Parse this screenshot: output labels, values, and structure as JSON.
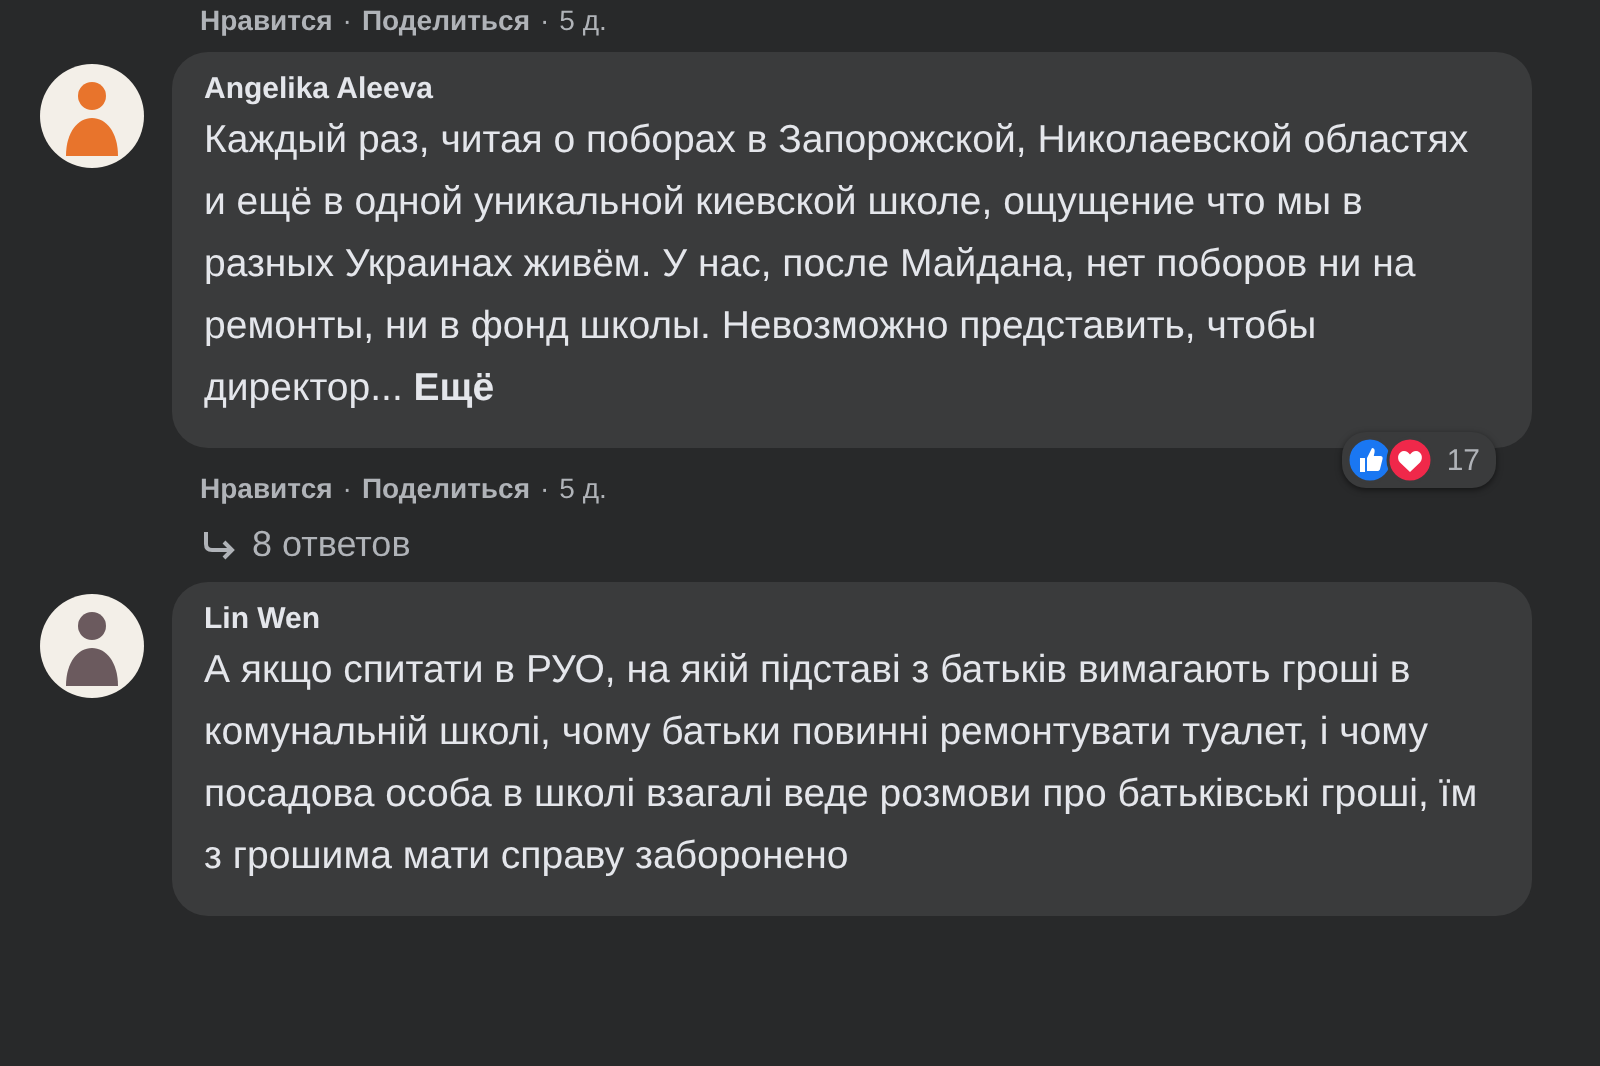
{
  "top_actions": {
    "like": "Нравится",
    "sep": "·",
    "share": "Поделиться",
    "time": "5 д."
  },
  "comments": [
    {
      "author": "Angelika Aleeva",
      "text": "Каждый раз, читая о поборах в Запорожской, Николаевской областях и ещё в одной уникальной киевской школе, ощущение что мы в разных Украинах живём. У нас, после Майдана, нет поборов ни на ремонты, ни в фонд школы. Невозможно представить, чтобы директор...",
      "see_more": "Ещё",
      "reactions": {
        "count": "17",
        "like": true,
        "love": true
      },
      "actions": {
        "like": "Нравится",
        "sep": "·",
        "share": "Поделиться",
        "time": "5 д."
      },
      "replies": "8 ответов"
    },
    {
      "author": "Lin Wen",
      "text": "А якщо спитати в РУО, на якій підставі з батьків вимагають гроші в комунальній школі, чому батьки повинні ремонтувати туалет, і чому посадова особа в школі взагалі веде розмови про батьківські гроші, їм з грошима мати справу заборонено"
    }
  ]
}
